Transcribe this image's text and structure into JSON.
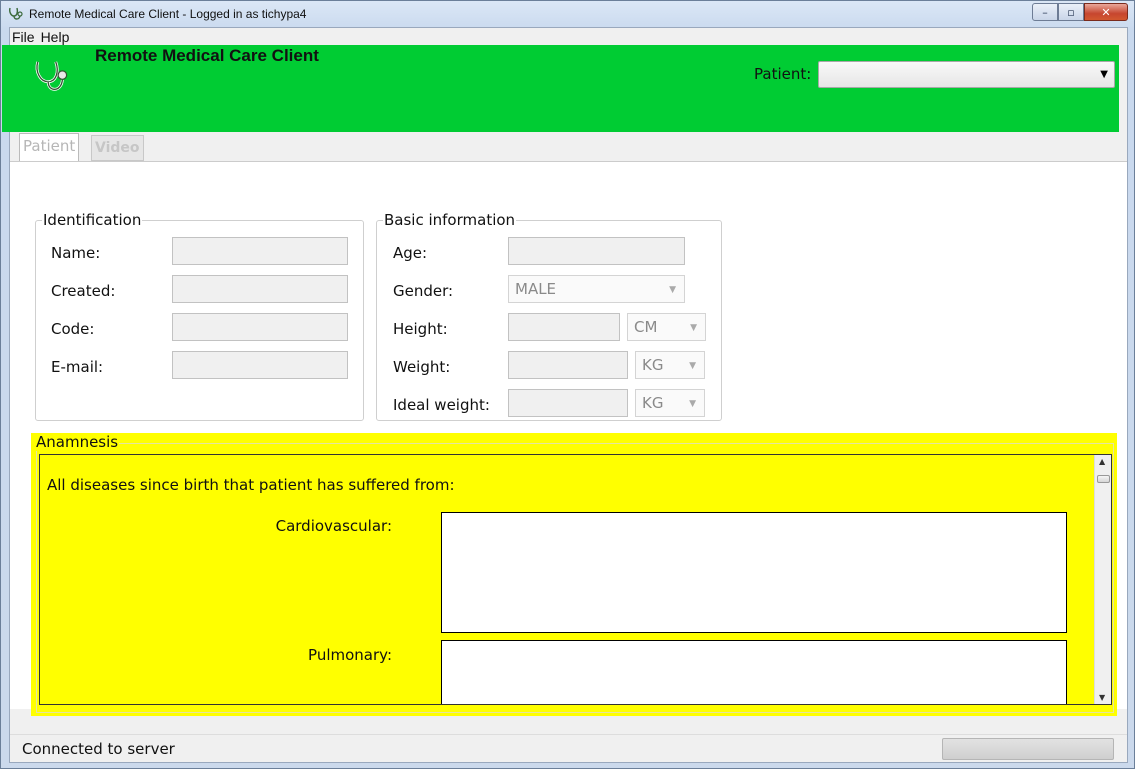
{
  "window": {
    "title": "Remote Medical Care Client - Logged in as tichypa4",
    "min_glyph": "–",
    "max_glyph": "▫",
    "close_glyph": "✕"
  },
  "menu": {
    "items": [
      {
        "label": "File"
      },
      {
        "label": "Help"
      }
    ]
  },
  "header": {
    "app_name": "Remote Medical Care Client",
    "logo_icon": "stethoscope-icon",
    "background_color": "#00cc33",
    "patient_label": "Patient:",
    "patient_selected": ""
  },
  "tabs": [
    {
      "label": "Patient",
      "active": true
    },
    {
      "label": "Video",
      "active": false
    }
  ],
  "identification": {
    "legend": "Identification",
    "fields": [
      {
        "label": "Name:",
        "value": ""
      },
      {
        "label": "Created:",
        "value": ""
      },
      {
        "label": "Code:",
        "value": ""
      },
      {
        "label": "E-mail:",
        "value": ""
      }
    ]
  },
  "basic_info": {
    "legend": "Basic information",
    "age_label": "Age:",
    "age_value": "",
    "gender_label": "Gender:",
    "gender_value": "MALE",
    "height_label": "Height:",
    "height_value": "",
    "height_unit": "CM",
    "weight_label": "Weight:",
    "weight_value": "",
    "weight_unit": "KG",
    "ideal_weight_label": "Ideal weight:",
    "ideal_weight_value": "",
    "ideal_weight_unit": "KG"
  },
  "anamnesis": {
    "legend": "Anamnesis",
    "background_color": "#ffff00",
    "intro": "All diseases since birth that patient has suffered from:",
    "cardiovascular_label": "Cardiovascular:",
    "cardiovascular_value": "",
    "pulmonary_label": "Pulmonary:",
    "pulmonary_value": ""
  },
  "status": {
    "text": "Connected to server"
  }
}
